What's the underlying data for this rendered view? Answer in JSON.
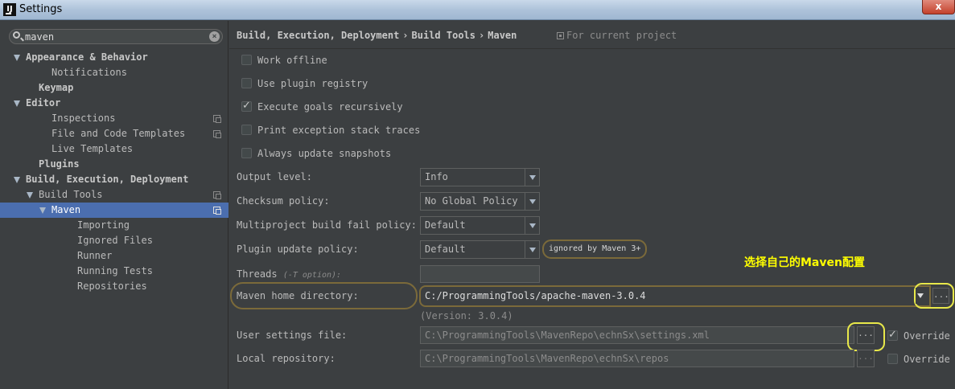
{
  "window": {
    "title": "Settings",
    "close": "x"
  },
  "search": {
    "value": "maven"
  },
  "tree": [
    {
      "label": "Appearance & Behavior",
      "indent": 0,
      "expanded": true,
      "bold": true,
      "copy": false
    },
    {
      "label": "Notifications",
      "indent": 2,
      "bold": false,
      "copy": false
    },
    {
      "label": "Keymap",
      "indent": 1,
      "bold": true,
      "copy": false
    },
    {
      "label": "Editor",
      "indent": 0,
      "expanded": true,
      "bold": true,
      "copy": false
    },
    {
      "label": "Inspections",
      "indent": 2,
      "bold": false,
      "copy": true
    },
    {
      "label": "File and Code Templates",
      "indent": 2,
      "bold": false,
      "copy": true
    },
    {
      "label": "Live Templates",
      "indent": 2,
      "bold": false,
      "copy": false
    },
    {
      "label": "Plugins",
      "indent": 1,
      "bold": true,
      "copy": false
    },
    {
      "label": "Build, Execution, Deployment",
      "indent": 0,
      "expanded": true,
      "bold": true,
      "copy": false
    },
    {
      "label": "Build Tools",
      "indent": 1,
      "expanded": true,
      "bold": false,
      "copy": true
    },
    {
      "label": "Maven",
      "indent": 2,
      "expanded": true,
      "bold": false,
      "copy": true,
      "selected": true
    },
    {
      "label": "Importing",
      "indent": 4,
      "bold": false,
      "copy": false
    },
    {
      "label": "Ignored Files",
      "indent": 4,
      "bold": false,
      "copy": false
    },
    {
      "label": "Runner",
      "indent": 4,
      "bold": false,
      "copy": false
    },
    {
      "label": "Running Tests",
      "indent": 4,
      "bold": false,
      "copy": false
    },
    {
      "label": "Repositories",
      "indent": 4,
      "bold": false,
      "copy": false
    }
  ],
  "breadcrumb": {
    "part1": "Build, Execution, Deployment",
    "part2": "Build Tools",
    "part3": "Maven",
    "sep": "›",
    "scope": "For current project"
  },
  "checkboxes": [
    {
      "label": "Work offline",
      "checked": false
    },
    {
      "label": "Use plugin registry",
      "checked": false
    },
    {
      "label": "Execute goals recursively",
      "checked": true
    },
    {
      "label": "Print exception stack traces",
      "checked": false
    },
    {
      "label": "Always update snapshots",
      "checked": false
    }
  ],
  "fields": {
    "output_level": {
      "label": "Output level:",
      "value": "Info"
    },
    "checksum_policy": {
      "label": "Checksum policy:",
      "value": "No Global Policy"
    },
    "multiproject": {
      "label": "Multiproject build fail policy:",
      "value": "Default"
    },
    "plugin_update": {
      "label": "Plugin update policy:",
      "value": "Default",
      "badge": "ignored by Maven 3+"
    },
    "threads": {
      "label": "Threads",
      "hint": "(-T option):",
      "value": ""
    },
    "maven_home": {
      "label": "Maven home directory:",
      "value": "C:/ProgrammingTools/apache-maven-3.0.4",
      "version": "(Version: 3.0.4)"
    },
    "user_settings": {
      "label": "User settings file:",
      "value": "C:\\ProgrammingTools\\MavenRepo\\echnSx\\settings.xml",
      "override": "Override",
      "override_checked": true
    },
    "local_repo": {
      "label": "Local repository:",
      "value": "C:\\ProgrammingTools\\MavenRepo\\echnSx\\repos",
      "override": "Override",
      "override_checked": false
    }
  },
  "browse_label": "...",
  "annotation": "选择自己的Maven配置",
  "colors": {
    "selection": "#4b6eaf",
    "highlight": "#e8e84a",
    "annotation": "#ffff00"
  }
}
